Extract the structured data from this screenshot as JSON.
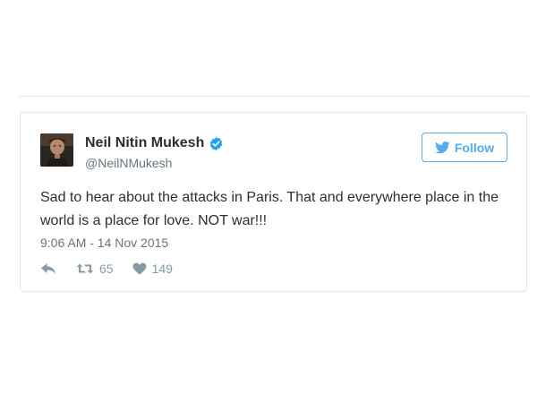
{
  "tweet": {
    "author": {
      "display_name": "Neil Nitin Mukesh",
      "handle": "@NeilNMukesh",
      "verified": true,
      "avatar": "profile-photo"
    },
    "follow_button": {
      "label": "Follow",
      "icon": "twitter-bird-icon"
    },
    "text": "Sad to hear about the attacks in Paris. That and everywhere place in the world is a place for love. NOT war!!!",
    "timestamp": "9:06 AM - 14 Nov 2015",
    "actions": {
      "reply": {
        "icon": "reply-icon"
      },
      "retweet": {
        "icon": "retweet-icon",
        "count": "65"
      },
      "like": {
        "icon": "heart-icon",
        "count": "149"
      }
    }
  },
  "colors": {
    "brand_blue": "#55acee",
    "verified_blue": "#1da1f2",
    "text_primary": "#292f33",
    "text_secondary": "#66757f",
    "action_gray": "#8899a6",
    "border": "#e1e8ed"
  }
}
